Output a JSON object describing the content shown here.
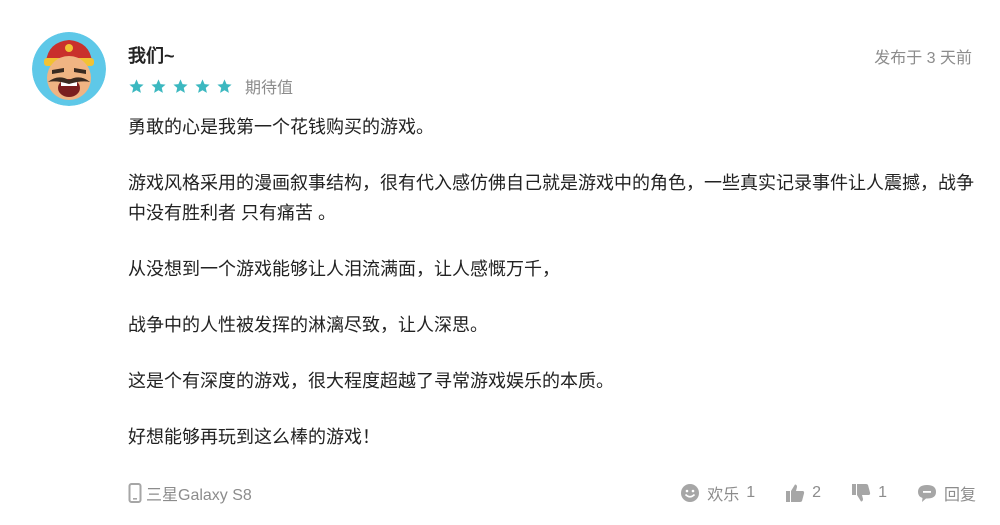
{
  "review": {
    "author": "我们~",
    "timestamp": "发布于 3 天前",
    "rating": 5,
    "rating_max": 5,
    "rating_label": "期待值",
    "paragraphs": [
      "勇敢的心是我第一个花钱购买的游戏。",
      "游戏风格采用的漫画叙事结构，很有代入感仿佛自己就是游戏中的角色，一些真实记录事件让人震撼，战争中没有胜利者 只有痛苦 。",
      "从没想到一个游戏能够让人泪流满面，让人感慨万千，",
      "战争中的人性被发挥的淋漓尽致，让人深思。",
      "这是个有深度的游戏，很大程度超越了寻常游戏娱乐的本质。",
      "好想能够再玩到这么棒的游戏！"
    ],
    "device": "三星Galaxy S8",
    "actions": {
      "fun_label": "欢乐",
      "fun_count": "1",
      "like_count": "2",
      "dislike_count": "1",
      "reply_label": "回复"
    }
  },
  "colors": {
    "star": "#3cb8c0",
    "muted": "#8c8c8c",
    "text": "#222222",
    "icon": "#a6a6a6"
  },
  "icons": [
    "avatar",
    "star-icon",
    "phone-icon",
    "smiley-icon",
    "thumbs-up-icon",
    "thumbs-down-icon",
    "speech-bubble-icon"
  ]
}
